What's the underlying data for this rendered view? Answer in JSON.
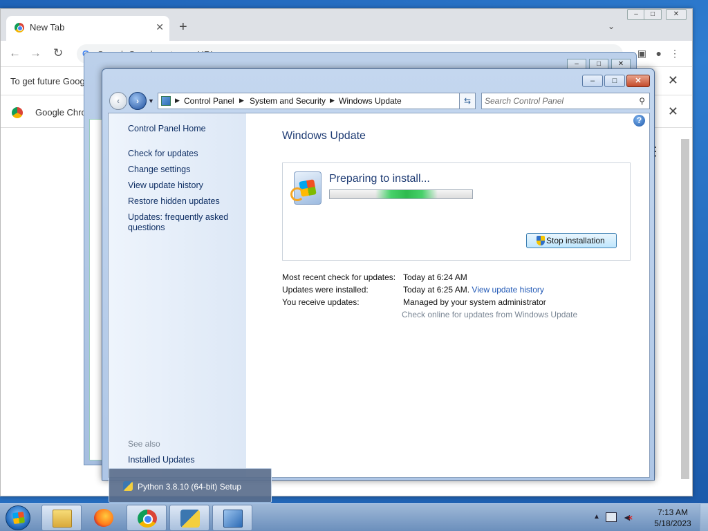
{
  "chrome": {
    "tab_title": "New Tab",
    "omnibox_placeholder": "Search Google or type a URL",
    "infobar_text": "To get future Goog",
    "infobar2_text": "Google Chro"
  },
  "windows_update": {
    "breadcrumb": [
      "Control Panel",
      "System and Security",
      "Windows Update"
    ],
    "search_placeholder": "Search Control Panel",
    "sidebar": {
      "home": "Control Panel Home",
      "links": [
        "Check for updates",
        "Change settings",
        "View update history",
        "Restore hidden updates",
        "Updates: frequently asked questions"
      ],
      "see_also_label": "See also",
      "see_also_links": [
        "Installed Updates"
      ]
    },
    "title": "Windows Update",
    "status": {
      "heading": "Preparing to install...",
      "progress": "indeterminate",
      "stop_button": "Stop installation"
    },
    "info": {
      "recent_check_label": "Most recent check for updates:",
      "recent_check_value": "Today at 6:24 AM",
      "installed_label": "Updates were installed:",
      "installed_value": "Today at 6:25 AM.",
      "installed_link": "View update history",
      "receive_label": "You receive updates:",
      "receive_value": "Managed by your system administrator",
      "online_link": "Check online for updates from Windows Update"
    }
  },
  "taskbar": {
    "tooltip": "Python 3.8.10 (64-bit) Setup",
    "apps": [
      "windows-explorer",
      "firefox",
      "google-chrome",
      "python-setup",
      "control-panel"
    ],
    "time": "7:13 AM",
    "date": "5/18/2023"
  },
  "colors": {
    "desktop": "#2f7dd0",
    "link": "#1f57b5",
    "heading": "#1f3c74",
    "progress_glow": "#2fbb4f"
  }
}
